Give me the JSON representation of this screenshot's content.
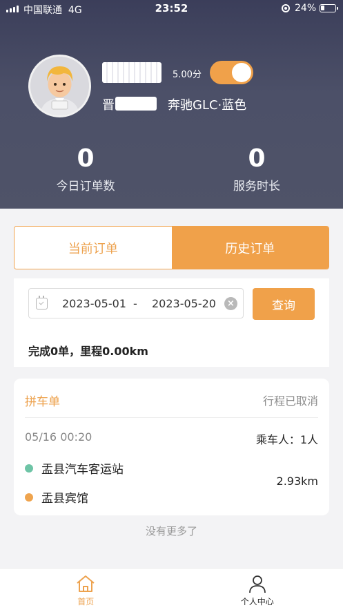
{
  "status_bar": {
    "carrier": "中国联通",
    "network": "4G",
    "time": "23:52",
    "battery": "24%"
  },
  "driver": {
    "name": "",
    "rating": "5.00分",
    "online": true,
    "plate_prefix": "晋",
    "car": "奔驰GLC·蓝色"
  },
  "stats": [
    {
      "value": "0",
      "label": "今日订单数"
    },
    {
      "value": "0",
      "label": "服务时长"
    }
  ],
  "tabs": {
    "current": "当前订单",
    "history": "历史订单",
    "active": "history"
  },
  "filter": {
    "start_date": "2023-05-01",
    "separator": "-",
    "end_date": "2023-05-20",
    "query_label": "查询",
    "summary": "完成0单，里程0.00km"
  },
  "order": {
    "type": "拼车单",
    "status": "行程已取消",
    "time": "05/16 00:20",
    "passengers": "乘车人：1人",
    "origin": "盂县汽车客运站",
    "destination": "盂县宾馆",
    "distance": "2.93km"
  },
  "no_more": "没有更多了",
  "nav": {
    "home": "首页",
    "profile": "个人中心"
  },
  "colors": {
    "accent": "#f0a14a",
    "header": "#4c5068",
    "origin_dot": "#6ec4a6",
    "destination_dot": "#efa44e"
  }
}
